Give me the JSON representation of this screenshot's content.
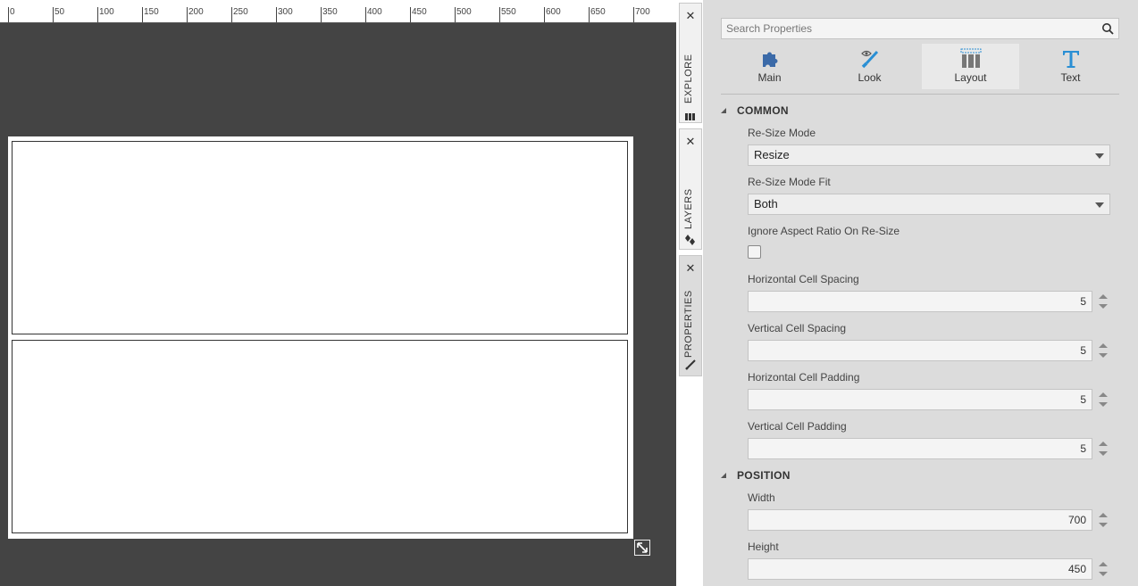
{
  "ruler": {
    "labels": [
      "0",
      "50",
      "100",
      "150",
      "200",
      "250",
      "300",
      "350",
      "400",
      "450",
      "500",
      "550",
      "600",
      "650",
      "700"
    ]
  },
  "side_tabs": [
    {
      "label": "EXPLORE",
      "close": "✕",
      "icon": "explore-icon",
      "active": false
    },
    {
      "label": "LAYERS",
      "close": "✕",
      "icon": "layers-icon",
      "active": false
    },
    {
      "label": "PROPERTIES",
      "close": "✕",
      "icon": "brush-icon",
      "active": true
    }
  ],
  "search": {
    "placeholder": "Search Properties",
    "icon": "search-icon"
  },
  "categories": [
    {
      "label": "Main",
      "icon": "puzzle-icon",
      "active": false
    },
    {
      "label": "Look",
      "icon": "brush-eye-icon",
      "active": false
    },
    {
      "label": "Layout",
      "icon": "layout-columns-icon",
      "active": true
    },
    {
      "label": "Text",
      "icon": "text-t-icon",
      "active": false
    }
  ],
  "sections": {
    "common": {
      "title": "COMMON",
      "resize_mode": {
        "label": "Re-Size Mode",
        "value": "Resize"
      },
      "resize_mode_fit": {
        "label": "Re-Size Mode Fit",
        "value": "Both"
      },
      "ignore_aspect": {
        "label": "Ignore Aspect Ratio On Re-Size",
        "checked": false
      },
      "h_cell_spacing": {
        "label": "Horizontal Cell Spacing",
        "value": "5"
      },
      "v_cell_spacing": {
        "label": "Vertical Cell Spacing",
        "value": "5"
      },
      "h_cell_padding": {
        "label": "Horizontal Cell Padding",
        "value": "5"
      },
      "v_cell_padding": {
        "label": "Vertical Cell Padding",
        "value": "5"
      }
    },
    "position": {
      "title": "POSITION",
      "width": {
        "label": "Width",
        "value": "700"
      },
      "height": {
        "label": "Height",
        "value": "450"
      }
    }
  },
  "colors": {
    "canvas_bg": "#444444",
    "panel_bg": "#dcdcdc",
    "accent_blue": "#2a8fd4"
  }
}
